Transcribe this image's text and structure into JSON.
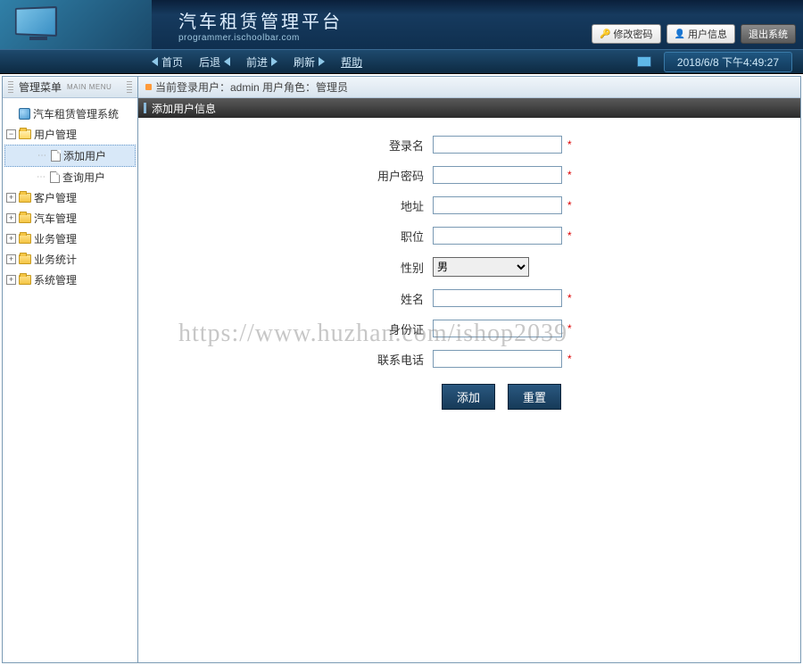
{
  "header": {
    "title": "汽车租赁管理平台",
    "subtitle": "programmer.ischoolbar.com",
    "btn_password": "修改密码",
    "btn_userinfo": "用户信息",
    "btn_logout": "退出系统"
  },
  "nav": {
    "home": "首页",
    "back": "后退",
    "forward": "前进",
    "refresh": "刷新",
    "help": "帮助",
    "clock": "2018/6/8 下午4:49:27"
  },
  "sidebar": {
    "title": "管理菜单",
    "subtitle": "MAIN MENU",
    "root": "汽车租赁管理系统",
    "user_mgmt": "用户管理",
    "add_user": "添加用户",
    "query_user": "查询用户",
    "customer_mgmt": "客户管理",
    "car_mgmt": "汽车管理",
    "biz_mgmt": "业务管理",
    "biz_stat": "业务统计",
    "sys_mgmt": "系统管理"
  },
  "status": {
    "text": "当前登录用户：admin  用户角色：管理员"
  },
  "panel": {
    "title": "添加用户信息"
  },
  "form": {
    "login_name": "登录名",
    "password": "用户密码",
    "address": "地址",
    "position": "职位",
    "gender": "性别",
    "gender_value": "男",
    "name": "姓名",
    "idcard": "身份证",
    "phone": "联系电话",
    "btn_add": "添加",
    "btn_reset": "重置"
  },
  "watermark": "https://www.huzhan.com/ishop2039"
}
